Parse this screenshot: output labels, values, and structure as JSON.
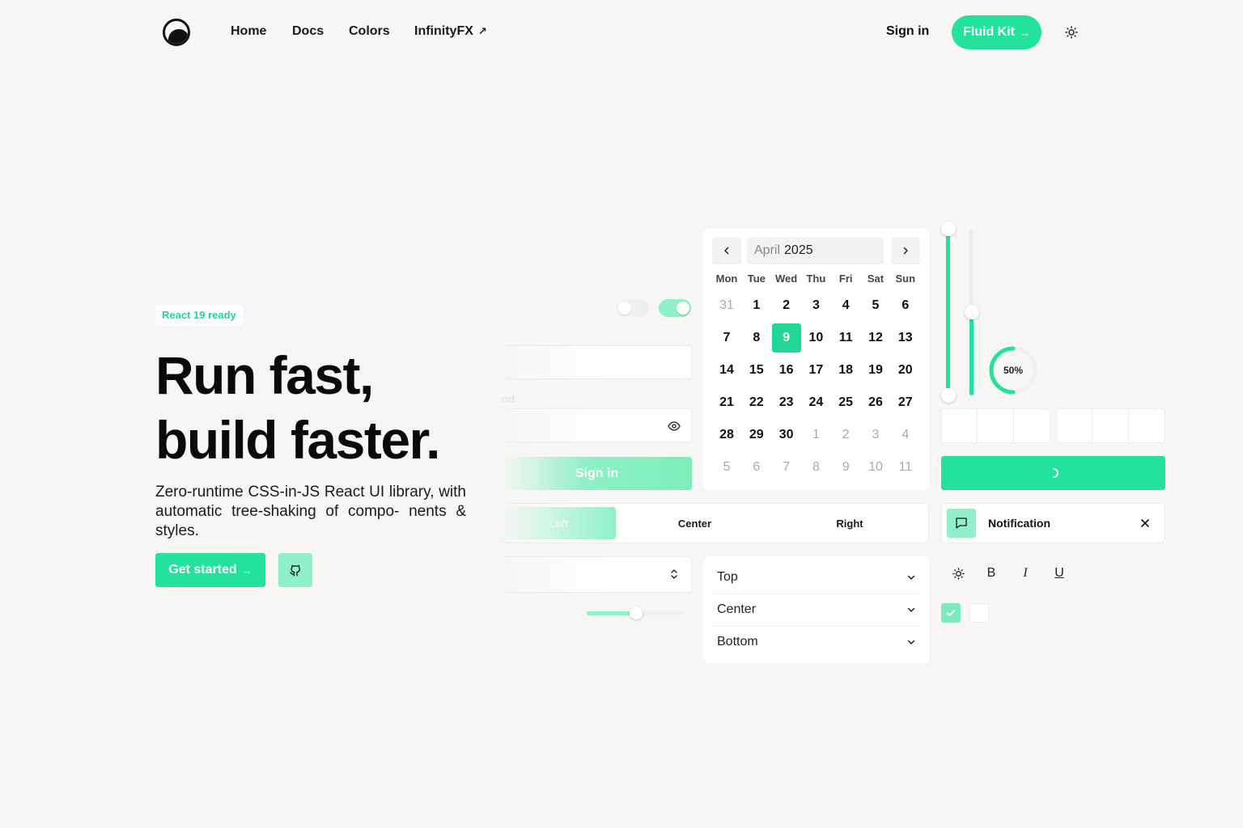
{
  "nav": {
    "links": [
      "Home",
      "Docs",
      "Colors",
      "InfinityFX"
    ],
    "external_icon": "↗",
    "sign_in": "Sign in",
    "cta": "Fluid Kit",
    "cta_icon": "→",
    "theme_icon": "sun-icon"
  },
  "hero": {
    "badge": "React 19 ready",
    "headline_line1": "Run fast,",
    "headline_line2": "build faster.",
    "subtext": "Zero-runtime CSS-in-JS React UI library, with automatic tree-shaking of compo- nents & styles.",
    "primary_button": "Get started",
    "primary_icon": "→",
    "secondary_icon": "github-icon"
  },
  "form": {
    "password_label": "ord",
    "submit": "Sign in",
    "toggles": [
      false,
      true
    ],
    "slider_value": 0.5
  },
  "segmented": {
    "options": [
      "Left",
      "Center",
      "Right"
    ],
    "selected": "Left"
  },
  "calendar": {
    "month": "April",
    "year": "2025",
    "weekdays": [
      "Mon",
      "Tue",
      "Wed",
      "Thu",
      "Fri",
      "Sat",
      "Sun"
    ],
    "weeks": [
      [
        "31",
        "1",
        "2",
        "3",
        "4",
        "5",
        "6"
      ],
      [
        "7",
        "8",
        "9",
        "10",
        "11",
        "12",
        "13"
      ],
      [
        "14",
        "15",
        "16",
        "17",
        "18",
        "19",
        "20"
      ],
      [
        "21",
        "22",
        "23",
        "24",
        "25",
        "26",
        "27"
      ],
      [
        "28",
        "29",
        "30",
        "1",
        "2",
        "3",
        "4"
      ],
      [
        "5",
        "6",
        "7",
        "8",
        "9",
        "10",
        "11"
      ]
    ],
    "selected_day": "9"
  },
  "progress": {
    "label": "50%",
    "value": 0.5
  },
  "vertical_sliders": [
    1.0,
    0.5
  ],
  "notification": {
    "text": "Notification",
    "icon": "message-icon",
    "close_icon": "close-icon"
  },
  "accordion": {
    "items": [
      "Top",
      "Center",
      "Bottom"
    ]
  },
  "toolbar": {
    "items": [
      "sun-icon",
      "B",
      "I",
      "U"
    ]
  },
  "colors": {
    "accent": "#22e29d",
    "accent_light": "#8ff0c9",
    "background": "#f7f6f4"
  }
}
